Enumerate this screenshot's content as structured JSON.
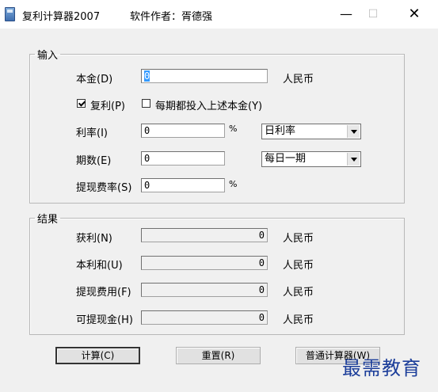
{
  "window": {
    "title": "复利计算器2007",
    "author": "软件作者：胥德强",
    "min_glyph": "—",
    "max_glyph": "☐",
    "close_glyph": "✕"
  },
  "input_group": {
    "legend": "输入",
    "principal": {
      "label": "本金(D)",
      "value": "0",
      "unit": "人民币"
    },
    "compound": {
      "label": "复利(P)",
      "checked": true
    },
    "reinvest": {
      "label": "每期都投入上述本金(Y)",
      "checked": false
    },
    "rate": {
      "label": "利率(I)",
      "value": "0",
      "unit": "%",
      "period_select": "日利率"
    },
    "periods": {
      "label": "期数(E)",
      "value": "0",
      "freq_select": "每日一期"
    },
    "fee": {
      "label": "提现费率(S)",
      "value": "0",
      "unit": "%"
    }
  },
  "result_group": {
    "legend": "结果",
    "rows": [
      {
        "label": "获利(N)",
        "value": "0",
        "unit": "人民币"
      },
      {
        "label": "本利和(U)",
        "value": "0",
        "unit": "人民币"
      },
      {
        "label": "提现费用(F)",
        "value": "0",
        "unit": "人民币"
      },
      {
        "label": "可提现金(H)",
        "value": "0",
        "unit": "人民币"
      }
    ]
  },
  "buttons": {
    "calculate": "计算(C)",
    "reset": "重置(R)",
    "normal_calc": "普通计算器(W)"
  },
  "watermark": "最需教育"
}
